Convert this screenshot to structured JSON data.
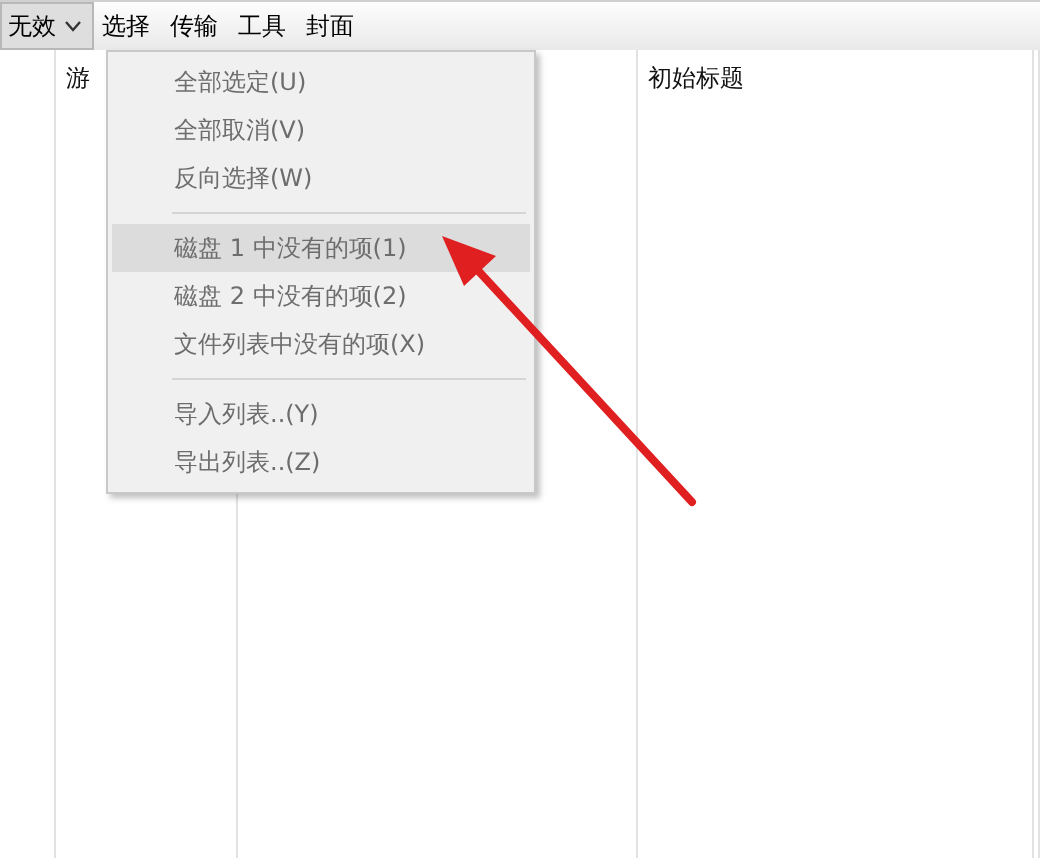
{
  "menu_bar": [
    {
      "label": "无效",
      "kind": "dropdown",
      "selected": true
    },
    {
      "label": "选择",
      "kind": "plain",
      "selected": false
    },
    {
      "label": "传输",
      "kind": "plain",
      "selected": false
    },
    {
      "label": "工具",
      "kind": "plain",
      "selected": false
    },
    {
      "label": "封面",
      "kind": "plain",
      "selected": false
    }
  ],
  "table": {
    "columns": [
      {
        "label": "游"
      },
      {
        "label": "初始标题"
      }
    ]
  },
  "dropdown_menu": {
    "items": [
      {
        "kind": "item",
        "label": "全部选定(U)",
        "selected": false
      },
      {
        "kind": "item",
        "label": "全部取消(V)",
        "selected": false
      },
      {
        "kind": "item",
        "label": "反向选择(W)",
        "selected": false
      },
      {
        "kind": "separator"
      },
      {
        "kind": "item",
        "label": "磁盘 1 中没有的项(1)",
        "selected": true
      },
      {
        "kind": "item",
        "label": "磁盘 2 中没有的项(2)",
        "selected": false
      },
      {
        "kind": "item",
        "label": "文件列表中没有的项(X)",
        "selected": false
      },
      {
        "kind": "separator"
      },
      {
        "kind": "item",
        "label": "导入列表..(Y)",
        "selected": false
      },
      {
        "kind": "item",
        "label": "导出列表..(Z)",
        "selected": false
      }
    ]
  }
}
